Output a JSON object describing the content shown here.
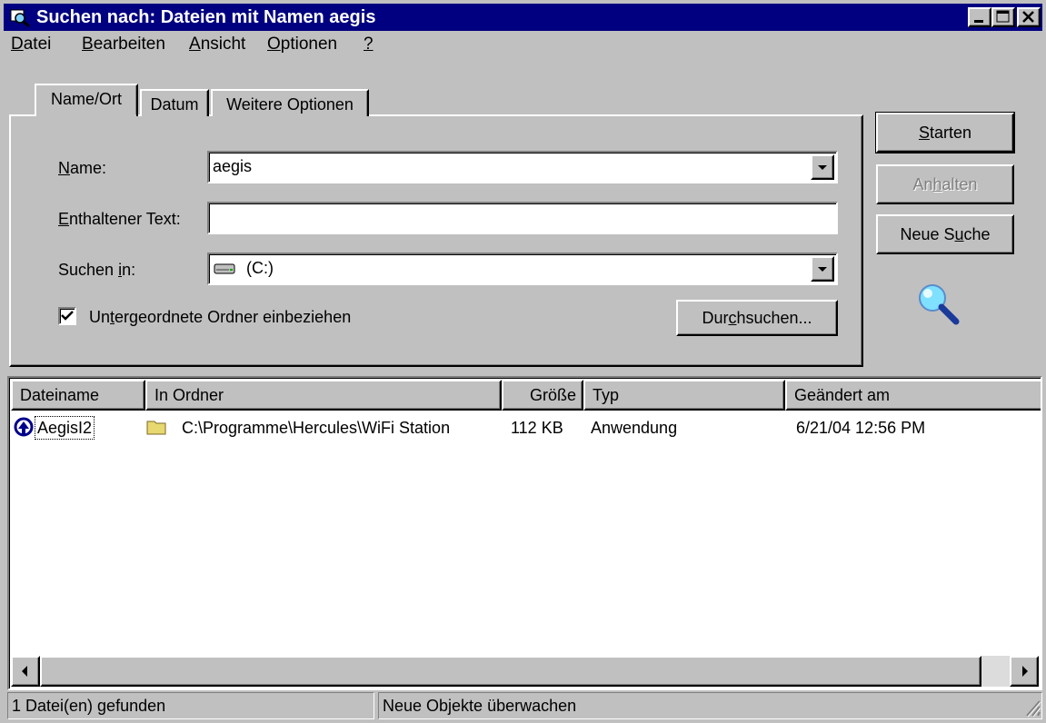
{
  "window": {
    "title": "Suchen nach: Dateien mit Namen aegis",
    "icon": "search-window-icon",
    "controls": [
      "minimize-icon",
      "maximize-icon",
      "close-icon"
    ]
  },
  "menu": [
    {
      "u": "D",
      "rest": "atei"
    },
    {
      "u": "B",
      "rest": "earbeiten"
    },
    {
      "u": "A",
      "rest": "nsicht"
    },
    {
      "u": "O",
      "rest": "ptionen"
    },
    {
      "u": "?",
      "rest": ""
    }
  ],
  "tabs": [
    {
      "label": "Name/Ort",
      "active": true
    },
    {
      "label": "Datum",
      "active": false
    },
    {
      "label": "Weitere Optionen",
      "active": false
    }
  ],
  "form": {
    "name_label_u": "N",
    "name_label_rest": "ame:",
    "name_value": "aegis",
    "text_label_u": "E",
    "text_label_rest": "nthaltener Text:",
    "text_value": "",
    "lookin_label_pre": "Suchen ",
    "lookin_label_u": "i",
    "lookin_label_rest": "n:",
    "lookin_value": "(C:)",
    "lookin_icon": "hard-drive-icon",
    "subfolders_pre": "Un",
    "subfolders_u": "t",
    "subfolders_rest": "ergeordnete Ordner einbeziehen",
    "subfolders_checked": true,
    "browse_pre": "Dur",
    "browse_u": "c",
    "browse_rest": "hsuchen..."
  },
  "buttons": {
    "start_u": "S",
    "start_rest": "tarten",
    "stop_pre": "An",
    "stop_u": "h",
    "stop_rest": "alten",
    "new_pre": "Neue S",
    "new_u": "u",
    "new_rest": "che",
    "magnifier_icon": "magnifier-icon"
  },
  "results": {
    "columns": [
      "Dateiname",
      "In Ordner",
      "Größe",
      "Typ",
      "Geändert am"
    ],
    "rows": [
      {
        "name": "AegisI2",
        "folder": "C:\\Programme\\Hercules\\WiFi Station",
        "size": "112 KB",
        "type": "Anwendung",
        "modified": "6/21/04 12:56 PM",
        "icon": "application-icon",
        "folder_icon": "folder-icon"
      }
    ]
  },
  "status": {
    "found": "1 Datei(en) gefunden",
    "monitor": "Neue Objekte überwachen"
  },
  "colors": {
    "titlebar": "#000080",
    "face": "#c0c0c0",
    "shadow": "#808080",
    "highlight": "#ffffff"
  }
}
